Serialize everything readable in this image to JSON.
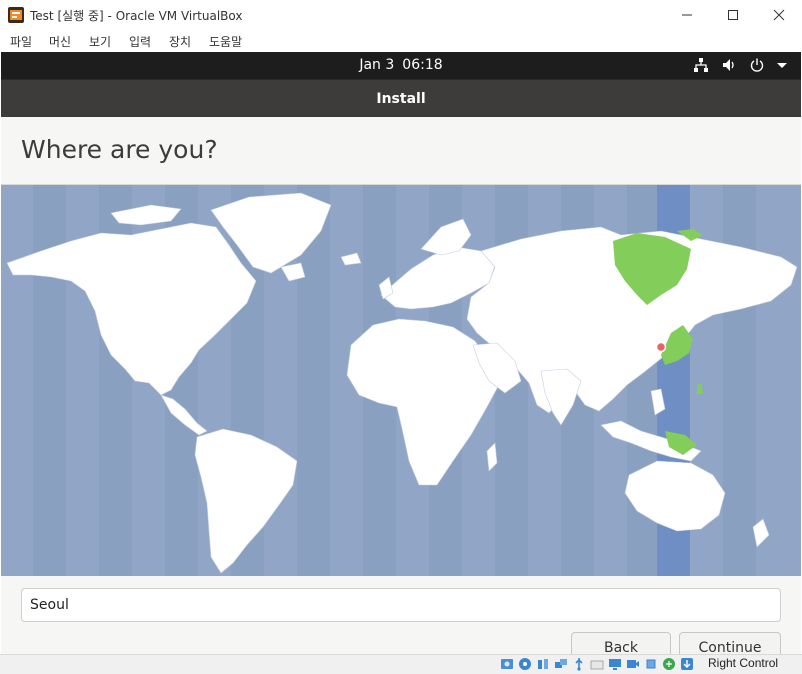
{
  "window": {
    "title": "Test [실행 중] - Oracle VM VirtualBox"
  },
  "menu": {
    "items": [
      {
        "label": "파일"
      },
      {
        "label": "머신"
      },
      {
        "label": "보기"
      },
      {
        "label": "입력"
      },
      {
        "label": "장치"
      },
      {
        "label": "도움말"
      }
    ]
  },
  "guest_panel": {
    "date": "Jan 3",
    "time": "06:18",
    "tray_icons": [
      "network-icon",
      "volume-icon",
      "power-icon",
      "dropdown-arrow-icon"
    ]
  },
  "installer": {
    "header_title": "Install",
    "page_title": "Where are you?",
    "timezone_value": "Seoul",
    "selected_zone": "Asia/Seoul",
    "back_label": "Back",
    "continue_label": "Continue"
  },
  "statusbar": {
    "host_key_label": "Right Control",
    "icons": [
      "hard-disk-icon",
      "optical-disk-icon",
      "audio-icon",
      "network-adapters-icon",
      "usb-icon",
      "shared-folders-icon",
      "display-icon",
      "recording-icon",
      "cpu-icon",
      "mouse-integration-icon",
      "keyboard-capture-icon"
    ]
  },
  "colors": {
    "ocean": "#91a6c6",
    "land": "#ffffff",
    "selected_zone_band": "#6f8fc4",
    "highlight_land": "#83ce5a",
    "pin": "#e96464",
    "header_bg": "#3d3c3a",
    "panel_bg": "#1d1d1d"
  }
}
